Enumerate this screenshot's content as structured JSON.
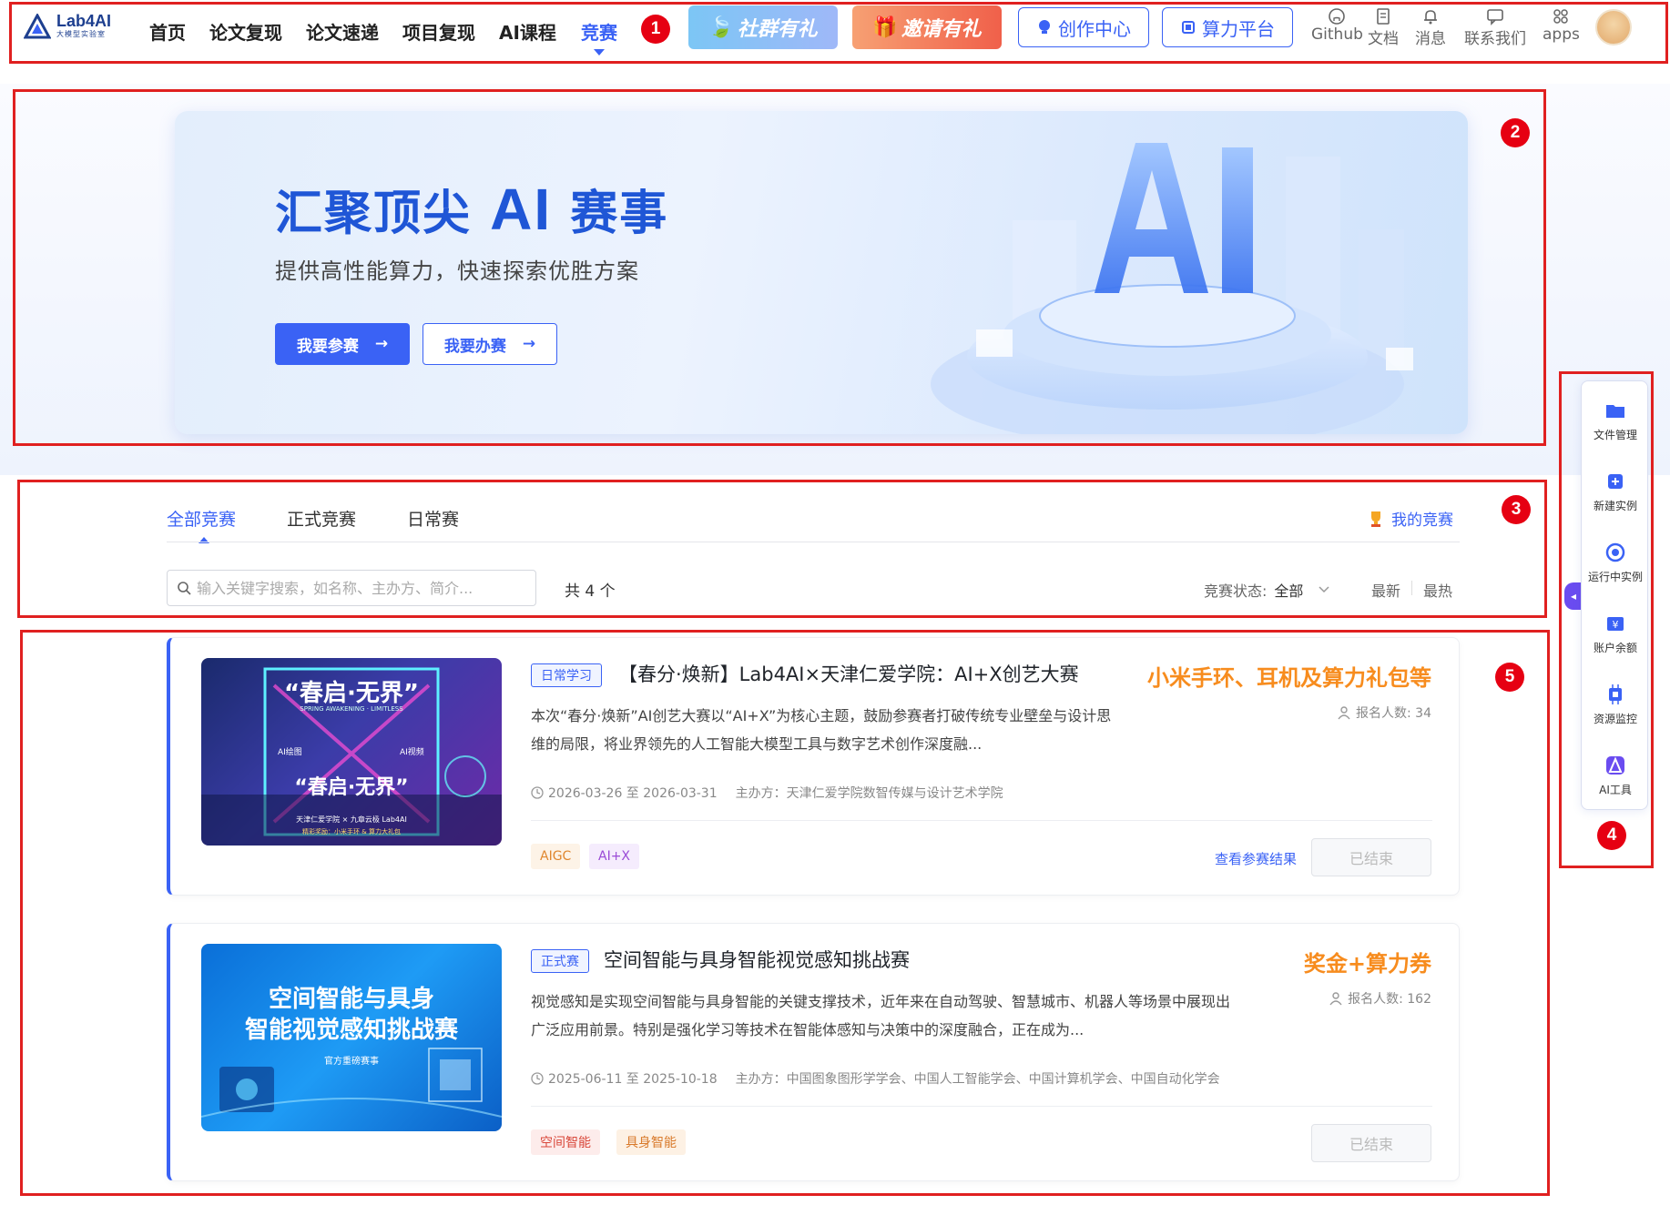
{
  "nav": {
    "logo_main": "Lab4AI",
    "logo_sub": "大模型实验室",
    "items": [
      "首页",
      "论文复现",
      "论文速递",
      "项目复现",
      "AI课程",
      "竞赛"
    ],
    "active_item": "竞赛",
    "promo1": "社群有礼",
    "promo2": "邀请有礼",
    "create_center": "创作中心",
    "compute_platform": "算力平台",
    "icons": [
      {
        "label": "Github",
        "icon": "github-icon"
      },
      {
        "label": "文档",
        "icon": "doc-icon"
      },
      {
        "label": "消息",
        "icon": "bell-icon"
      },
      {
        "label": "联系我们",
        "icon": "chat-icon"
      },
      {
        "label": "apps",
        "icon": "apps-icon"
      }
    ]
  },
  "hero": {
    "title_pre": "汇聚顶尖 ",
    "title_ai": "AI",
    "title_post": " 赛事",
    "subtitle": "提供高性能算力，快速探索优胜方案",
    "btn_join": "我要参赛",
    "btn_host": "我要办赛",
    "arrow": "→"
  },
  "filter": {
    "tabs": [
      "全部竞赛",
      "正式竞赛",
      "日常赛"
    ],
    "active_tab": "全部竞赛",
    "my_competitions": "我的竞赛",
    "search_placeholder": "输入关键字搜索，如名称、主办方、简介...",
    "total": "共 4 个",
    "status_label": "竞赛状态:",
    "status_value": "全部",
    "sort_latest": "最新",
    "sort_hottest": "最热"
  },
  "cards": [
    {
      "tag": "日常学习",
      "title": "【春分·焕新】Lab4AI×天津仁爱学院：AI+X创艺大赛",
      "prize": "小米手环、耳机及算力礼包等",
      "count": "报名人数: 34",
      "desc": "本次“春分·焕新”AI创艺大赛以“AI+X”为核心主题，鼓励参赛者打破传统专业壁垒与设计思维的局限，将业界领先的人工智能大模型工具与数字艺术创作深度融...",
      "date": "2026-03-26 至 2026-03-31",
      "organizer": "主办方：天津仁爱学院数智传媒与设计艺术学院",
      "chips": [
        "AIGC",
        "AI+X"
      ],
      "result_link": "查看参赛结果",
      "status": "已结束",
      "thumb_title": "“春启·无界”",
      "thumb_sub": "SPRING AWAKENING · LIMITLESS",
      "thumb_left": "AI绘图",
      "thumb_right": "AI视频",
      "thumb_footer": "天津仁爱学院 × 九章云极 Lab4AI",
      "thumb_prize": "精彩奖励：小米手环 & 算力大礼包"
    },
    {
      "tag": "正式赛",
      "title": "空间智能与具身智能视觉感知挑战赛",
      "prize": "奖金+算力券",
      "count": "报名人数: 162",
      "desc": "视觉感知是实现空间智能与具身智能的关键支撑技术，近年来在自动驾驶、智慧城市、机器人等场景中展现出广泛应用前景。特别是强化学习等技术在智能体感知与决策中的深度融合，正在成为...",
      "date": "2025-06-11 至 2025-10-18",
      "organizer": "主办方：中国图象图形学学会、中国人工智能学会、中国计算机学会、中国自动化学会",
      "chips": [
        "空间智能",
        "具身智能"
      ],
      "status": "已结束",
      "thumb_title_1": "空间智能与具身",
      "thumb_title_2": "智能视觉感知挑战赛",
      "thumb_badge": "官方重磅赛事"
    }
  ],
  "side": {
    "items": [
      {
        "label": "文件管理",
        "icon": "folder-icon"
      },
      {
        "label": "新建实例",
        "icon": "new-instance-icon"
      },
      {
        "label": "运行中实例",
        "icon": "running-icon"
      },
      {
        "label": "账户余额",
        "icon": "wallet-icon"
      },
      {
        "label": "资源监控",
        "icon": "chip-icon"
      },
      {
        "label": "AI工具",
        "icon": "ai-tool-icon"
      }
    ]
  },
  "badges": [
    "1",
    "2",
    "3",
    "4",
    "5"
  ],
  "colors": {
    "accent": "#3a62f5",
    "prize": "#f78c1e",
    "annotation": "#e02020"
  }
}
